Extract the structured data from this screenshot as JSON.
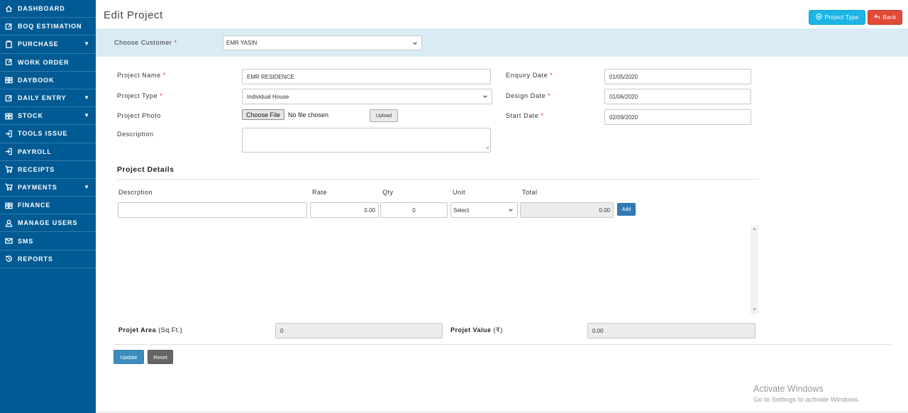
{
  "sidebar": {
    "items": [
      {
        "label": "DASHBOARD",
        "icon": "home-icon",
        "has_caret": false
      },
      {
        "label": "BOQ ESTIMATION",
        "icon": "edit-icon",
        "has_caret": false
      },
      {
        "label": "PURCHASE",
        "icon": "clipboard-icon",
        "has_caret": true
      },
      {
        "label": "WORK ORDER",
        "icon": "edit-icon",
        "has_caret": false
      },
      {
        "label": "DAYBOOK",
        "icon": "book-icon",
        "has_caret": false
      },
      {
        "label": "DAILY ENTRY",
        "icon": "edit-icon",
        "has_caret": true
      },
      {
        "label": "STOCK",
        "icon": "book-icon",
        "has_caret": true
      },
      {
        "label": "TOOLS ISSUE",
        "icon": "sign-in-icon",
        "has_caret": false
      },
      {
        "label": "PAYROLL",
        "icon": "sign-in-icon",
        "has_caret": false
      },
      {
        "label": "RECEIPTS",
        "icon": "cart-icon",
        "has_caret": false
      },
      {
        "label": "PAYMENTS",
        "icon": "cart-icon",
        "has_caret": true
      },
      {
        "label": "FINANCE",
        "icon": "book-icon",
        "has_caret": false
      },
      {
        "label": "MANAGE USERS",
        "icon": "user-icon",
        "has_caret": false
      },
      {
        "label": "SMS",
        "icon": "envelope-icon",
        "has_caret": false
      },
      {
        "label": "REPORTS",
        "icon": "history-icon",
        "has_caret": false
      }
    ],
    "caret": "▼"
  },
  "header": {
    "title": "Edit Project",
    "project_type_button": "Project Type",
    "back_button": "Back"
  },
  "customer": {
    "label": "Choose Customer",
    "value": "EMR YASIN"
  },
  "form": {
    "required_mark": "*",
    "project_name_label": "Project Name",
    "project_name_value": "EMR RESIDENCE",
    "project_type_label": "Project Type",
    "project_type_value": "Individual House",
    "project_photo_label": "Project Photo",
    "choose_file_button": "Choose File",
    "file_status": "No file chosen",
    "upload_button": "Upload",
    "description_label": "Description",
    "description_value": "",
    "enquiry_date_label": "Enquiry Date",
    "enquiry_date_value": "01/05/2020",
    "design_date_label": "Design Date",
    "design_date_value": "01/06/2020",
    "start_date_label": "Start Date",
    "start_date_value": "02/09/2020"
  },
  "details": {
    "title": "Project Details",
    "columns": [
      "Descrption",
      "Rate",
      "Qty",
      "Unit",
      "Total"
    ],
    "row": {
      "description": "",
      "rate": "0.00",
      "qty": "0",
      "unit": "Select",
      "total": "0.00"
    },
    "add_button": "Add",
    "scroll_up": "▲",
    "scroll_down": "▼"
  },
  "summary": {
    "area_label": "Projet Area",
    "area_unit": "(Sq.Ft.)",
    "area_value": "0",
    "value_label": "Projet Value",
    "value_unit": "(₹)",
    "value_value": "0.00"
  },
  "actions": {
    "update": "Update",
    "reset": "Reset"
  },
  "watermark": {
    "line1": "Activate Windows",
    "line2": "Go to Settings to activate Windows."
  },
  "colors": {
    "sidebar": "#005a93",
    "customer_band": "#d9ecf5",
    "project_type_button": "#1cb5e5",
    "back_button": "#e04b3a",
    "primary": "#337ab7"
  }
}
